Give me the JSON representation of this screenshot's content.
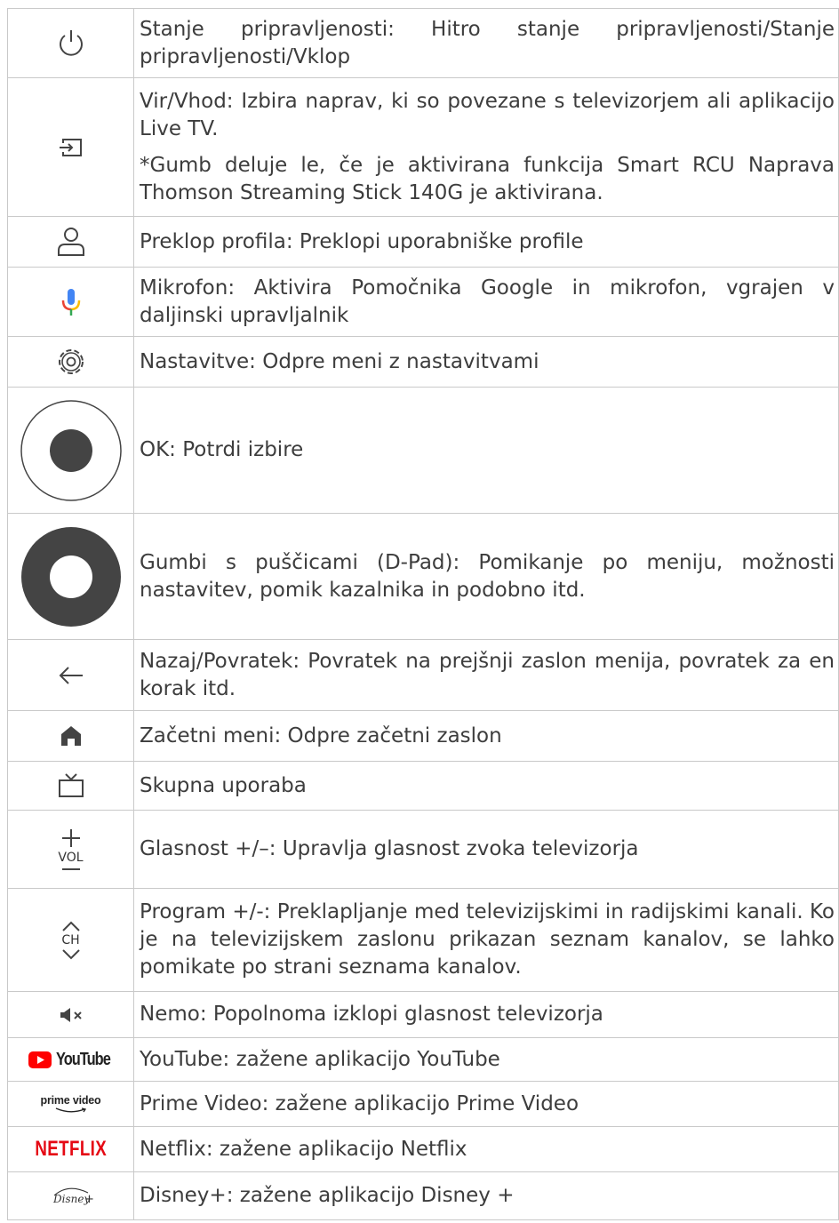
{
  "rows": [
    {
      "icon": "power-icon",
      "text": "Stanje pripravljenosti: Hitro stanje pripravljenosti/Stanje pripravljenosti/Vklop"
    },
    {
      "icon": "input-icon",
      "text": "Vir/Vhod: Izbira naprav, ki so povezane s televizorjem ali aplikacijo Live TV.",
      "note": "*Gumb deluje le, če je aktivirana funkcija Smart RCU Naprava Thomson Streaming Stick 140G je aktivirana."
    },
    {
      "icon": "profile-icon",
      "text": "Preklop profila: Preklopi uporabniške profile"
    },
    {
      "icon": "microphone-icon",
      "text": "Mikrofon: Aktivira Pomočnika Google in mikrofon, vgrajen v daljinski upravljalnik"
    },
    {
      "icon": "gear-icon",
      "text": "Nastavitve: Odpre meni z nastavitvami"
    },
    {
      "icon": "ok-button-icon",
      "text": "OK: Potrdi izbire"
    },
    {
      "icon": "dpad-icon",
      "text": "Gumbi s puščicami (D-Pad): Pomikanje po meniju, možnosti nastavitev, pomik kazalnika in podobno itd."
    },
    {
      "icon": "back-arrow-icon",
      "text": "Nazaj/Povratek: Povratek na prejšnji zaslon menija, povratek za en korak itd."
    },
    {
      "icon": "home-icon",
      "text": "Začetni meni: Odpre začetni zaslon"
    },
    {
      "icon": "tv-icon",
      "text": "Skupna uporaba"
    },
    {
      "icon": "volume-icon",
      "label": "VOL",
      "text": "Glasnost +/–: Upravlja glasnost zvoka televizorja"
    },
    {
      "icon": "channel-icon",
      "label": "CH",
      "text": "Program +/-: Preklapljanje med televizijskimi in radijskimi kanali. Ko je na televizijskem zaslonu prikazan seznam kanalov, se lahko pomikate po strani seznama kanalov."
    },
    {
      "icon": "mute-icon",
      "text": "Nemo: Popolnoma izklopi glasnost televizorja"
    },
    {
      "icon": "youtube-logo-icon",
      "logo": "YouTube",
      "text": "YouTube: zažene aplikacijo YouTube"
    },
    {
      "icon": "prime-video-logo-icon",
      "logo": "prime video",
      "text": "Prime Video: zažene aplikacijo Prime Video"
    },
    {
      "icon": "netflix-logo-icon",
      "logo": "NETFLIX",
      "text": "Netflix: zažene aplikacijo Netflix"
    },
    {
      "icon": "disney-plus-logo-icon",
      "logo": "Disney+",
      "text": "Disney+: zažene aplikacijo Disney +"
    }
  ],
  "colors": {
    "border": "#c9c9c9",
    "text": "#3d3d3d",
    "icon": "#444444",
    "youtube_red": "#ff0000",
    "netflix_red": "#e50914"
  }
}
